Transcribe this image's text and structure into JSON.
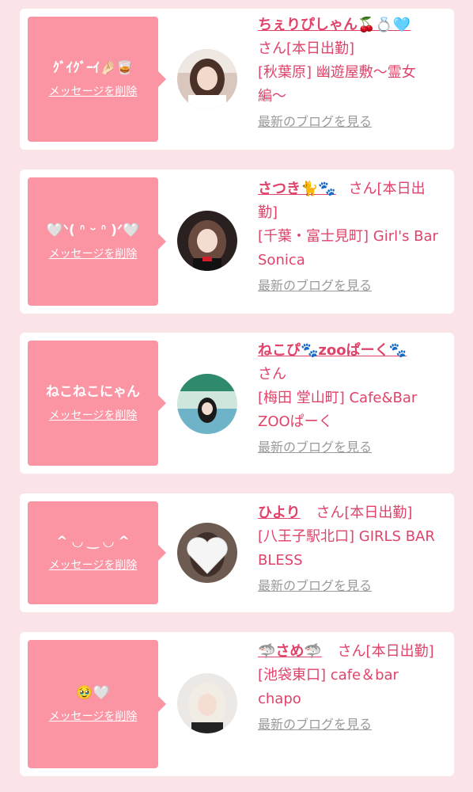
{
  "colors": {
    "page_bg": "#fbe4e8",
    "bubble": "#fb95a4",
    "accent": "#e0436a",
    "link_gray": "#9a9a9a"
  },
  "entries": [
    {
      "message": "ｸﾞｲｸﾞｰｲ🤌🏻🥃",
      "delete_label": "メッセージを削除",
      "name": "ちぇりぴしゃん🍒💍🩵",
      "suffix": "さん[本日出勤]",
      "shop": "[秋葉原] 幽遊屋敷〜霊女編〜",
      "blog_label": "最新のブログを見る",
      "avatar_icon": "girl-photo"
    },
    {
      "message": "🤍ᐠ( ᐢ ᵕ ᐢ )ᐟ🤍",
      "delete_label": "メッセージを削除",
      "name": "さつき🐈🐾",
      "suffix": "さん[本日出勤]",
      "shop": "[千葉・富士見町] Girl's Bar Sonica",
      "blog_label": "最新のブログを見る",
      "avatar_icon": "girl-photo"
    },
    {
      "message": "ねこねこにゃん",
      "delete_label": "メッセージを削除",
      "name": "ねこぴ🐾zooぱーく🐾",
      "suffix": "さん",
      "shop": "[梅田 堂山町] Cafe&Bar ZOOぱーく",
      "blog_label": "最新のブログを見る",
      "avatar_icon": "girl-photo"
    },
    {
      "message": "^ ◡ ‿ ◡ ^",
      "delete_label": "メッセージを削除",
      "name": "ひより",
      "suffix": "さん[本日出勤]",
      "shop": "[八王子駅北口] GIRLS BAR BLESS",
      "blog_label": "最新のブログを見る",
      "avatar_icon": "heart-avatar"
    },
    {
      "message": "🥹🤍",
      "delete_label": "メッセージを削除",
      "name": "🦈さめ🦈",
      "suffix": "さん[本日出勤]",
      "shop": "[池袋東口] cafe＆bar chapo",
      "blog_label": "最新のブログを見る",
      "avatar_icon": "girl-photo"
    }
  ]
}
